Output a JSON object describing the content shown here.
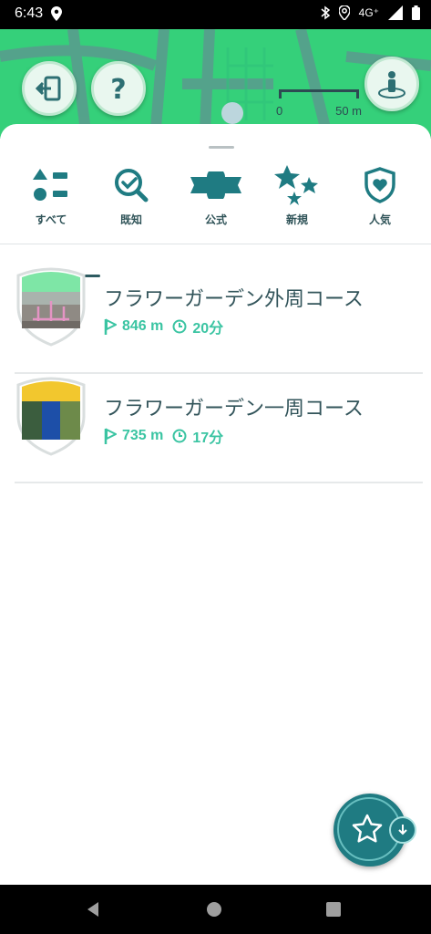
{
  "status_bar": {
    "time": "6:43",
    "network": "4G⁺"
  },
  "map": {
    "scale": {
      "start": "0",
      "end": "50 m"
    },
    "buttons": [
      "exit-icon",
      "help-icon",
      "player-icon"
    ]
  },
  "tabs": [
    {
      "label": "すべて",
      "icon": "shapes-icon",
      "selected": true
    },
    {
      "label": "既知",
      "icon": "search-check-icon",
      "selected": false
    },
    {
      "label": "公式",
      "icon": "banner-icon",
      "selected": false
    },
    {
      "label": "新規",
      "icon": "stars-icon",
      "selected": false
    },
    {
      "label": "人気",
      "icon": "heart-shield-icon",
      "selected": false
    }
  ],
  "routes": [
    {
      "title": "フラワーガーデン外周コース",
      "distance": "846 m",
      "duration": "20分",
      "badge_color": "#7ee6a6"
    },
    {
      "title": "フラワーガーデン一周コース",
      "distance": "735 m",
      "duration": "17分",
      "badge_color": "#f2c72e"
    }
  ],
  "colors": {
    "accent": "#3ac4a2",
    "teal": "#1f7b82",
    "map_green": "#35d07a",
    "text": "#32545a"
  }
}
